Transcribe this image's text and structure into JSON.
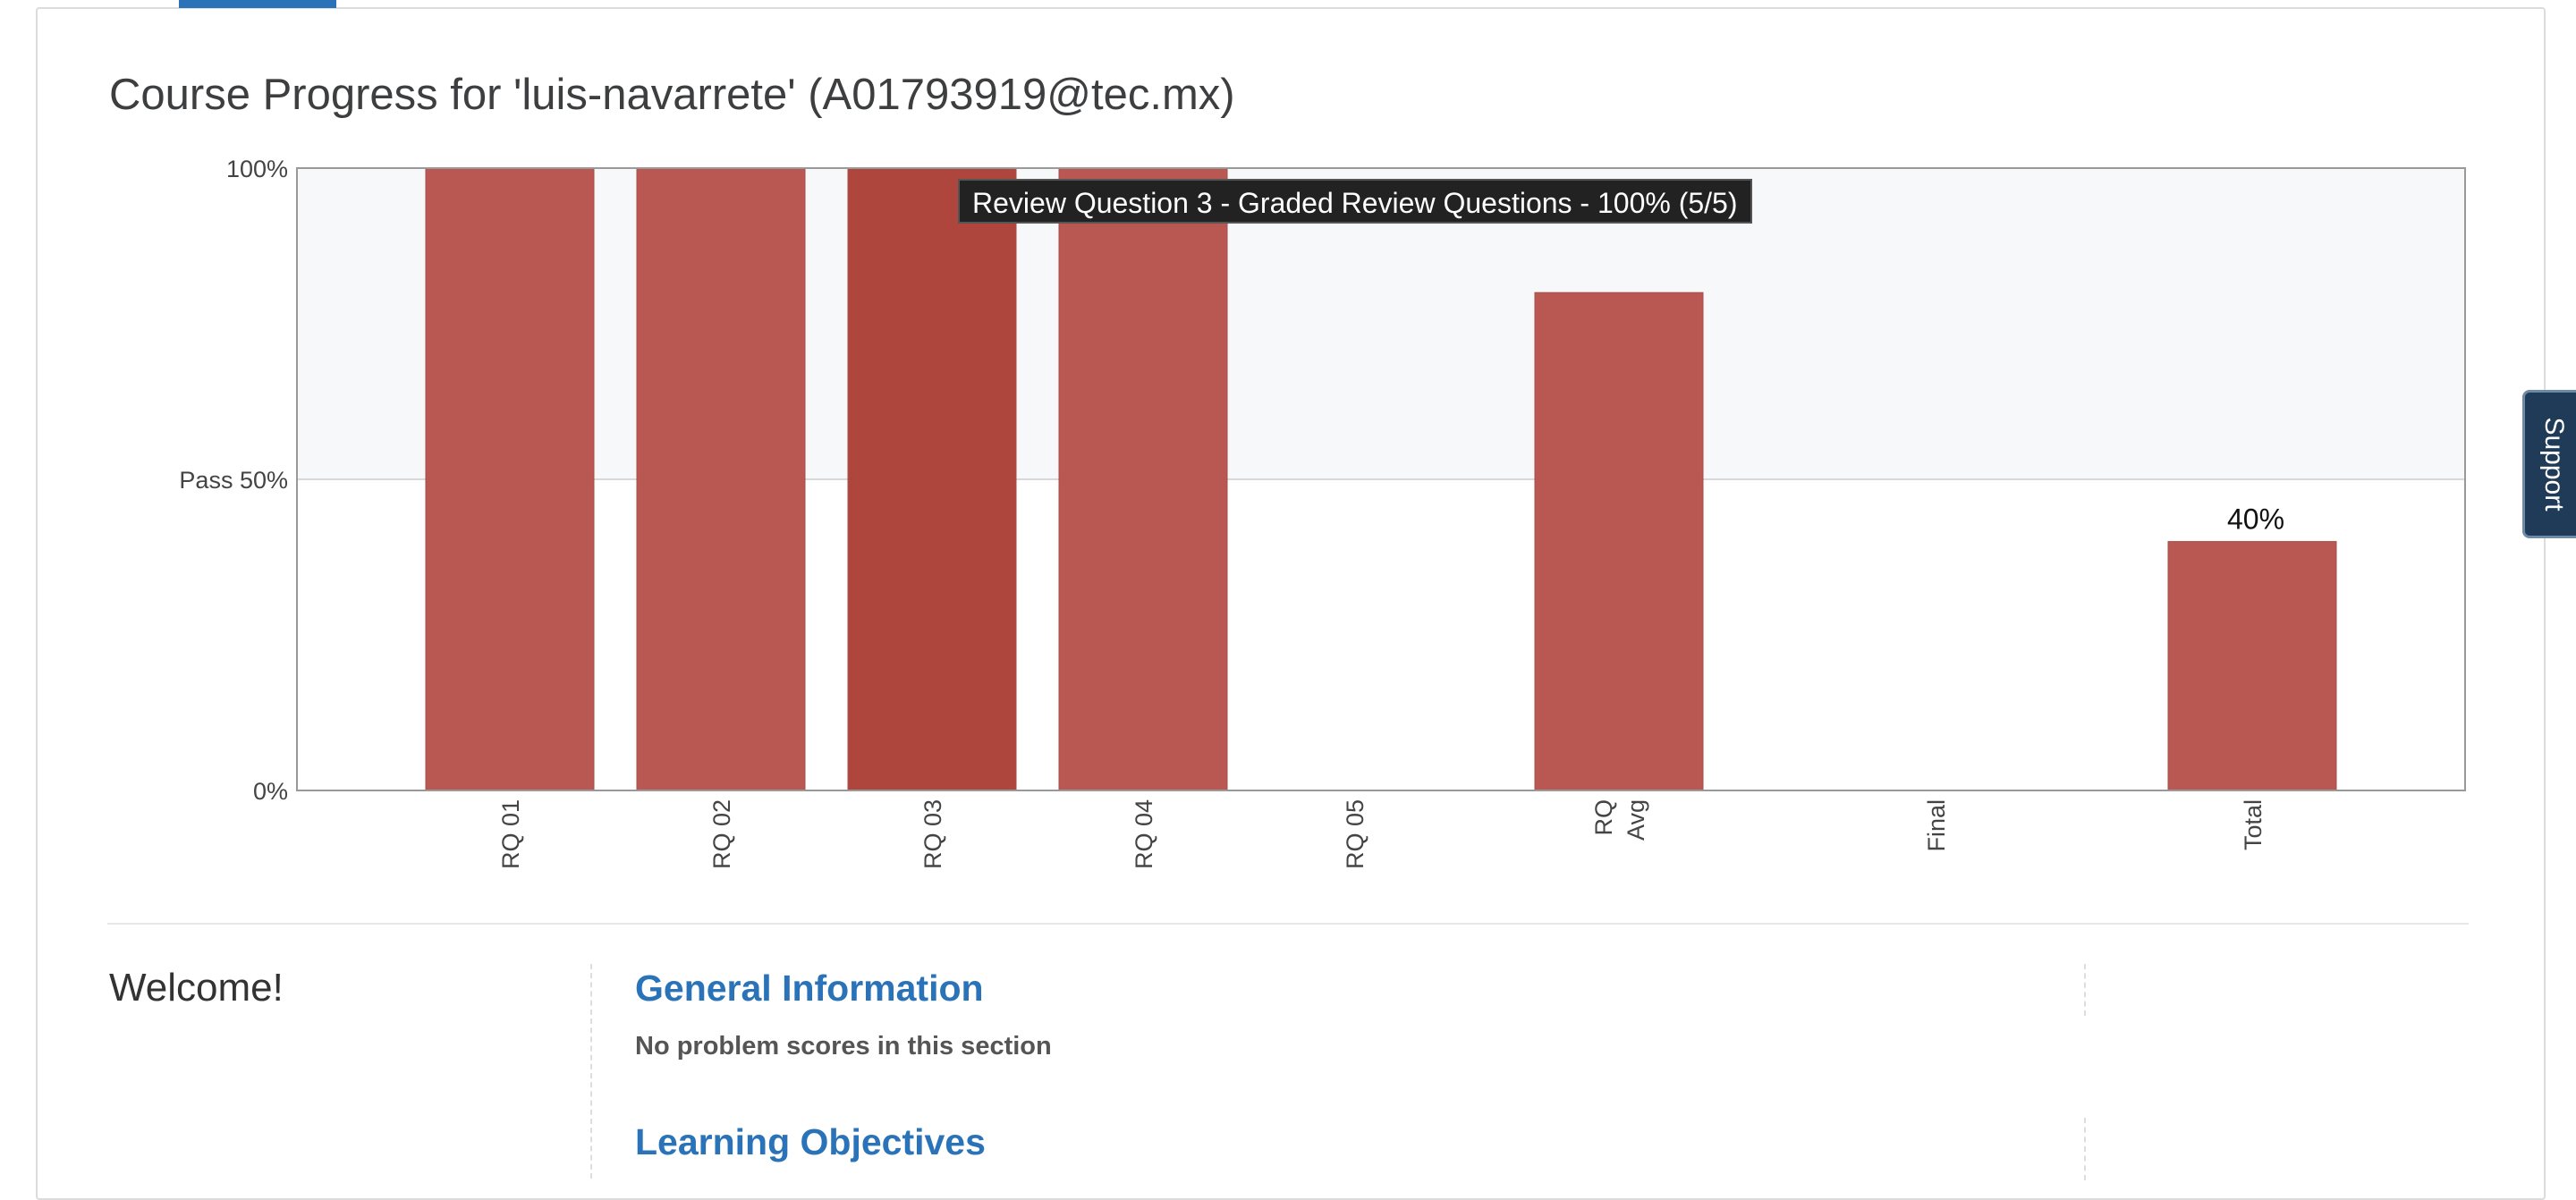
{
  "page": {
    "title": "Course Progress for 'luis-navarrete' (A01793919@tec.mx)"
  },
  "chart_data": {
    "type": "bar",
    "categories": [
      "RQ 01",
      "RQ 02",
      "RQ 03",
      "RQ 04",
      "RQ 05",
      "RQ Avg",
      "Final",
      "Total"
    ],
    "category_lines": [
      [
        "RQ 01"
      ],
      [
        "RQ 02"
      ],
      [
        "RQ 03"
      ],
      [
        "RQ 04"
      ],
      [
        "RQ 05"
      ],
      [
        "RQ",
        "Avg"
      ],
      [
        "Final"
      ],
      [
        "Total"
      ]
    ],
    "values": [
      100,
      100,
      100,
      100,
      0,
      80,
      0,
      40
    ],
    "highlighted_index": 2,
    "ylim": [
      0,
      100
    ],
    "yticks": [
      {
        "value": 0,
        "label": "0%"
      },
      {
        "value": 50,
        "label": "Pass 50%"
      },
      {
        "value": 100,
        "label": "100%"
      }
    ],
    "pass_threshold": 50,
    "data_labels": [
      {
        "index": 7,
        "label": "40%"
      }
    ],
    "tooltip": "Review Question 3 - Graded Review Questions - 100% (5/5)",
    "colors": {
      "bar": "#b85450",
      "bar_highlight": "#ad433b",
      "pass_region": "#f7f8fa",
      "axis": "#999999",
      "grid": "#d8d8d8"
    }
  },
  "sections": {
    "welcome": "Welcome!",
    "general_information": {
      "title": "General Information",
      "note": "No problem scores in this section"
    },
    "learning_objectives": {
      "title": "Learning Objectives"
    }
  },
  "support": {
    "label": "Support"
  }
}
